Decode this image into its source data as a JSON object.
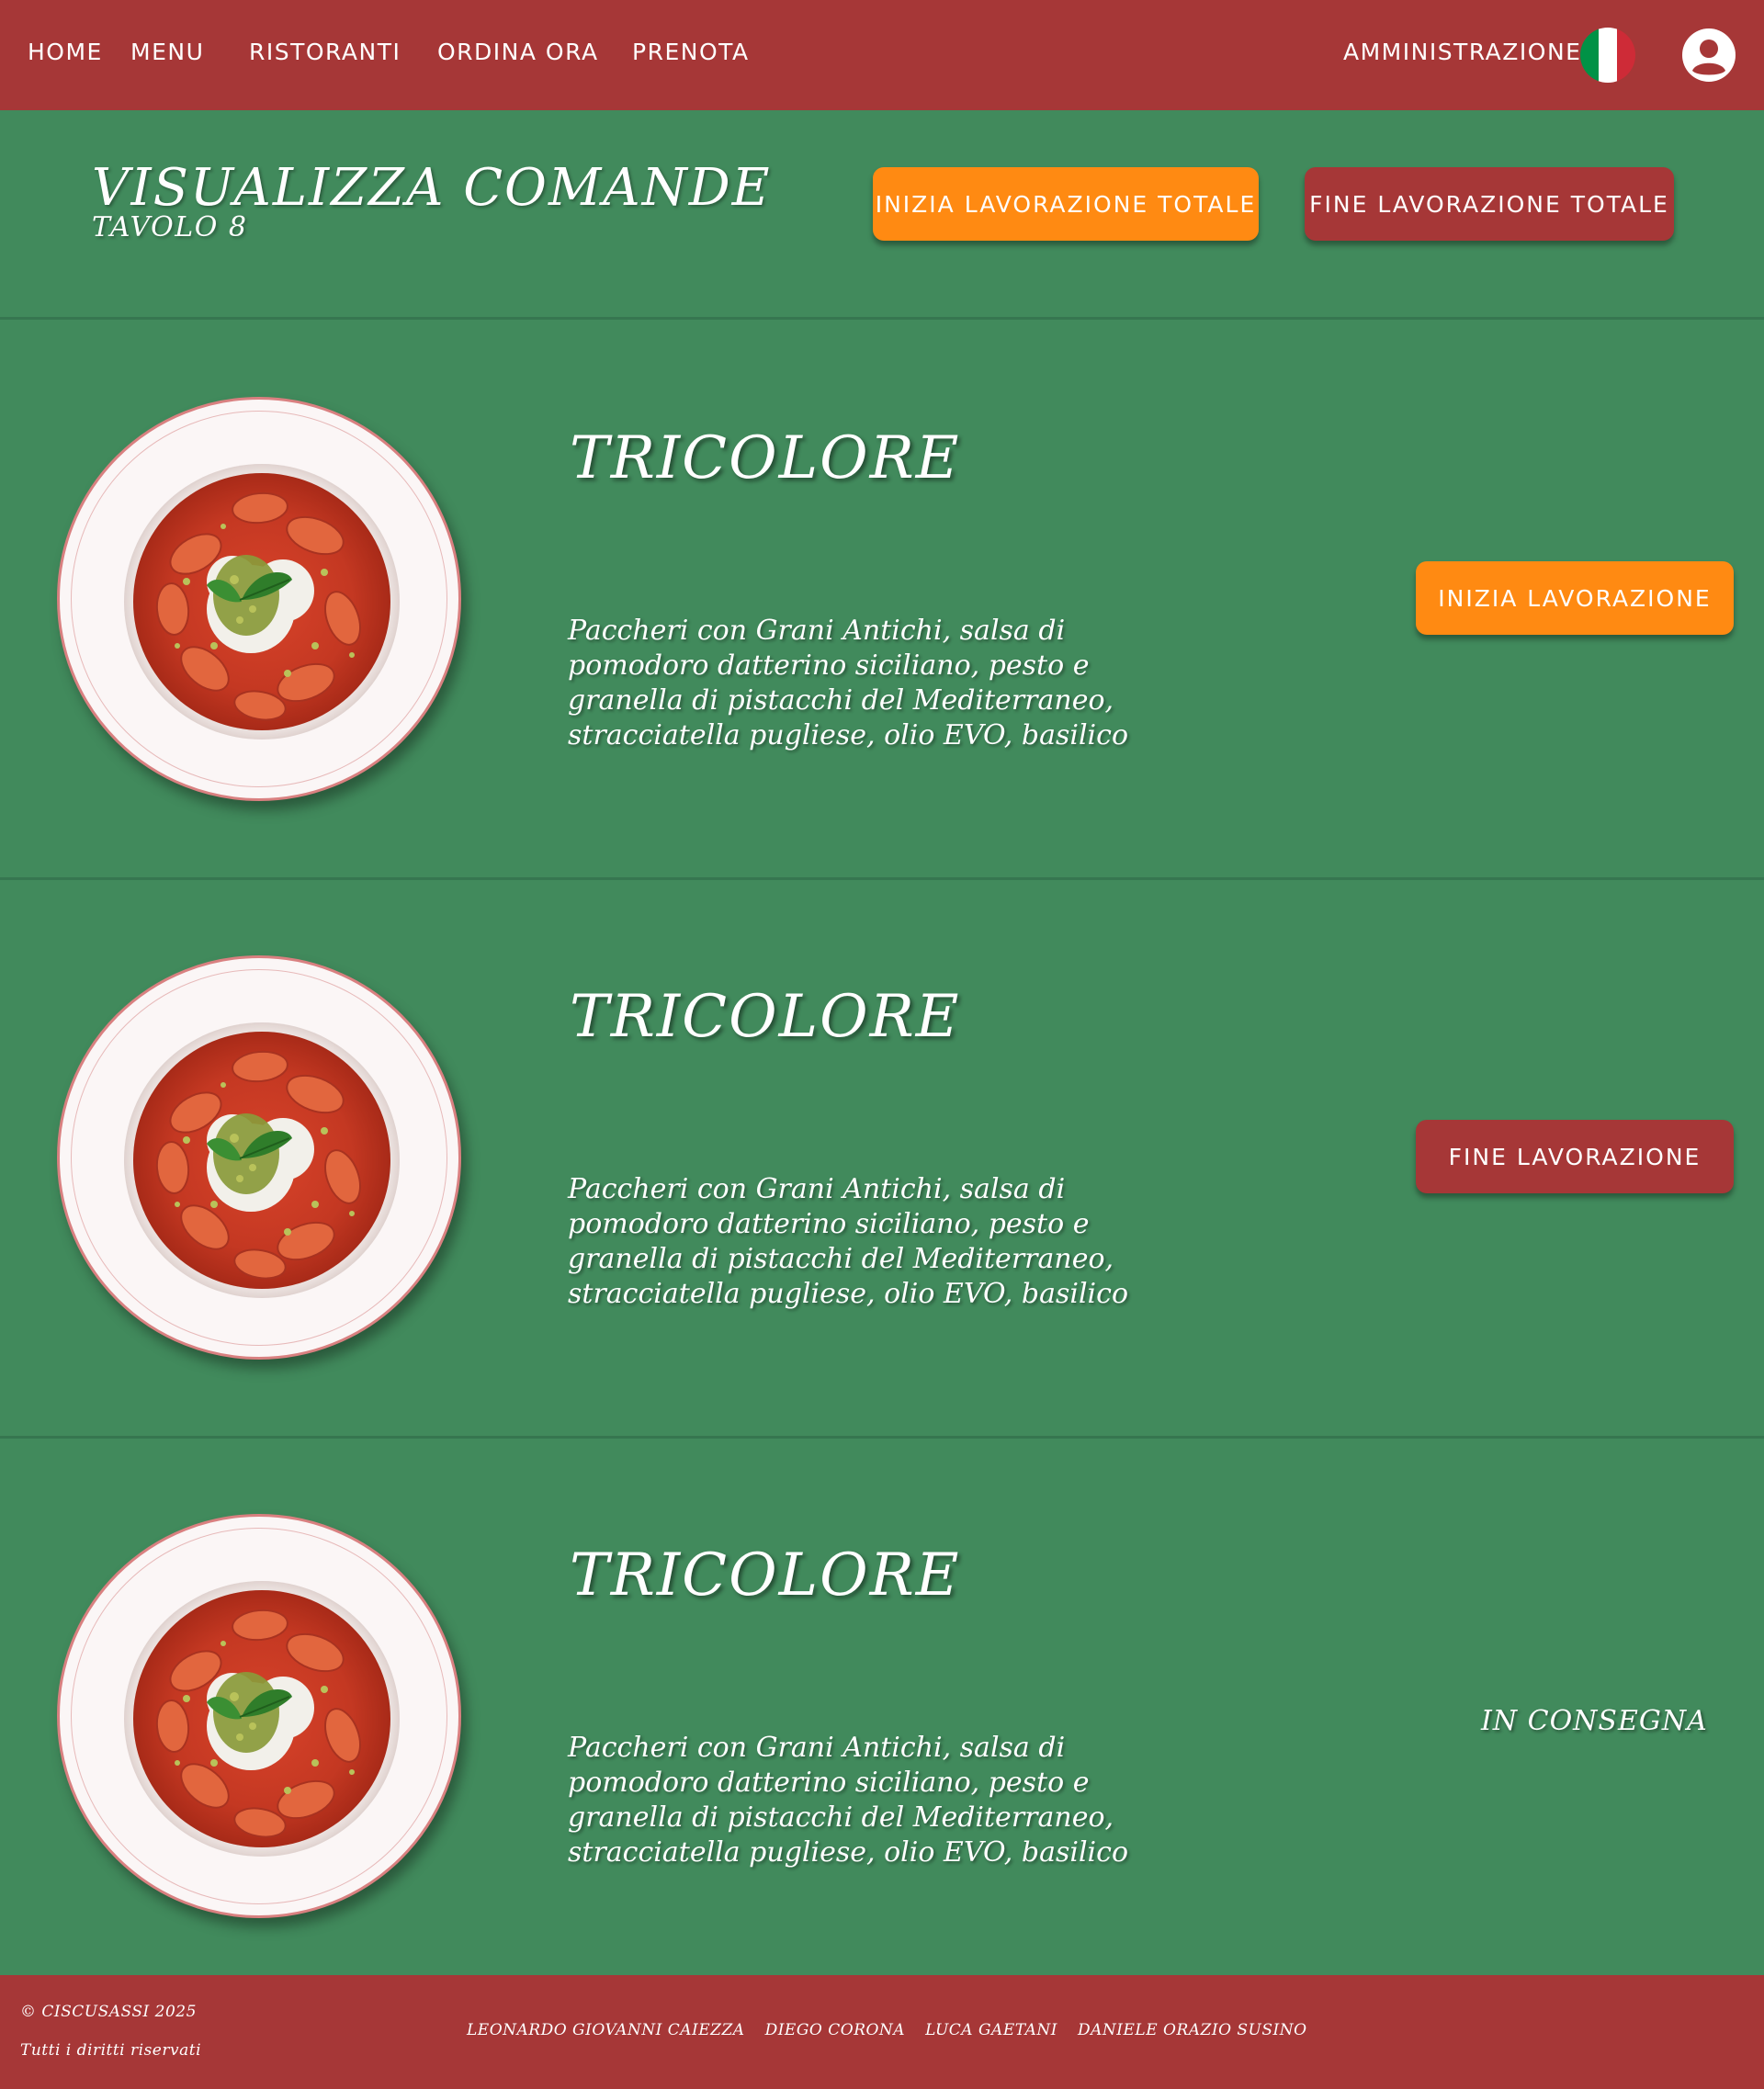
{
  "nav": {
    "links": [
      "HOME",
      "MENU",
      "RISTORANTI",
      "ORDINA ORA",
      "PRENOTA"
    ],
    "admin": "AMMINISTRAZIONE",
    "flag_colors": [
      "#009246",
      "#ffffff",
      "#ce2b37"
    ]
  },
  "header": {
    "title": "VISUALIZZA COMANDE",
    "subtitle": "TAVOLO 8",
    "start_all": "INIZIA LAVORAZIONE TOTALE",
    "end_all": "FINE LAVORAZIONE TOTALE"
  },
  "orders": [
    {
      "name": "TRICOLORE",
      "description": "Paccheri con Grani Antichi, salsa di pomodoro datterino siciliano, pesto e granella di pistacchi del Mediterraneo, stracciatella pugliese, olio  EVO, basilico",
      "action": "INIZIA LAVORAZIONE"
    },
    {
      "name": "TRICOLORE",
      "description": "Paccheri con Grani Antichi, salsa di pomodoro datterino siciliano, pesto e granella di pistacchi del Mediterraneo, stracciatella pugliese, olio  EVO, basilico",
      "action": "FINE LAVORAZIONE"
    },
    {
      "name": "TRICOLORE",
      "description": "Paccheri con Grani Antichi, salsa di pomodoro datterino siciliano, pesto e granella di pistacchi del Mediterraneo, stracciatella pugliese, olio  EVO, basilico",
      "status": "IN CONSEGNA"
    }
  ],
  "footer": {
    "copyright": "© CISCUSASSI 2025",
    "rights": "Tutti i diritti riservati",
    "authors": [
      "LEONARDO GIOVANNI CAIEZZA",
      "DIEGO CORONA",
      "LUCA GAETANI",
      "DANIELE ORAZIO SUSINO"
    ]
  },
  "colors": {
    "nav_red": "#a63737",
    "background_green": "#418a5c",
    "accent_orange": "#ff8a12"
  }
}
